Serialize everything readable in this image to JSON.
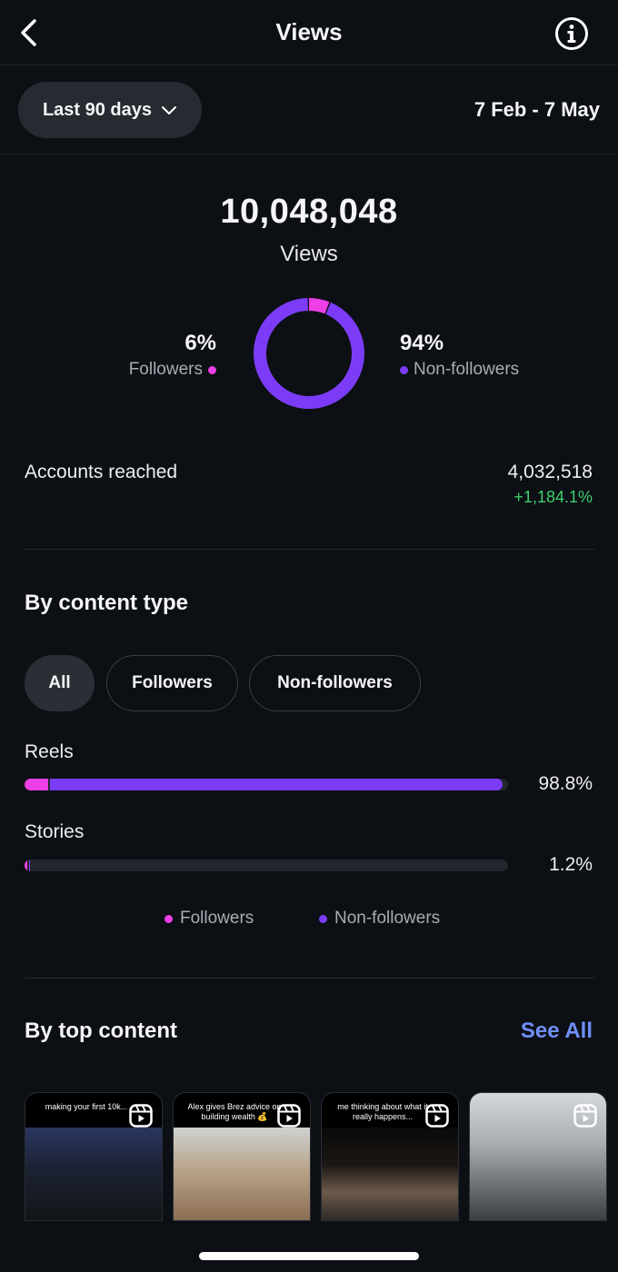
{
  "header": {
    "title": "Views",
    "back_icon": "chevron-left-icon",
    "info_icon": "info-icon"
  },
  "filter": {
    "range_label": "Last 90 days",
    "date_range": "7 Feb - 7 May"
  },
  "summary": {
    "total": "10,048,048",
    "label": "Views",
    "followers_pct": "6%",
    "followers_label": "Followers",
    "nonfollowers_pct": "94%",
    "nonfollowers_label": "Non-followers",
    "followers_fraction": 0.06
  },
  "reach": {
    "label": "Accounts reached",
    "value": "4,032,518",
    "change": "+1,184.1%"
  },
  "content_type": {
    "title": "By content type",
    "chips": [
      "All",
      "Followers",
      "Non-followers"
    ],
    "active_chip": "All",
    "rows": [
      {
        "label": "Reels",
        "pct": "98.8%",
        "total_fraction": 0.988,
        "followers_fraction": 0.05
      },
      {
        "label": "Stories",
        "pct": "1.2%",
        "total_fraction": 0.012,
        "followers_fraction": 0.5
      }
    ],
    "legend": [
      "Followers",
      "Non-followers"
    ]
  },
  "top_content": {
    "title": "By top content",
    "see_all": "See All",
    "items": [
      {
        "caption": "making your first 10k..."
      },
      {
        "caption": "Alex gives Brez advice on building wealth 💰"
      },
      {
        "caption": "me thinking about what it really happens..."
      },
      {
        "caption": ""
      }
    ]
  },
  "colors": {
    "followers": "#ec3fe6",
    "non_followers": "#7c3cf7",
    "positive": "#3ecf6e",
    "link": "#6f8ff7"
  }
}
